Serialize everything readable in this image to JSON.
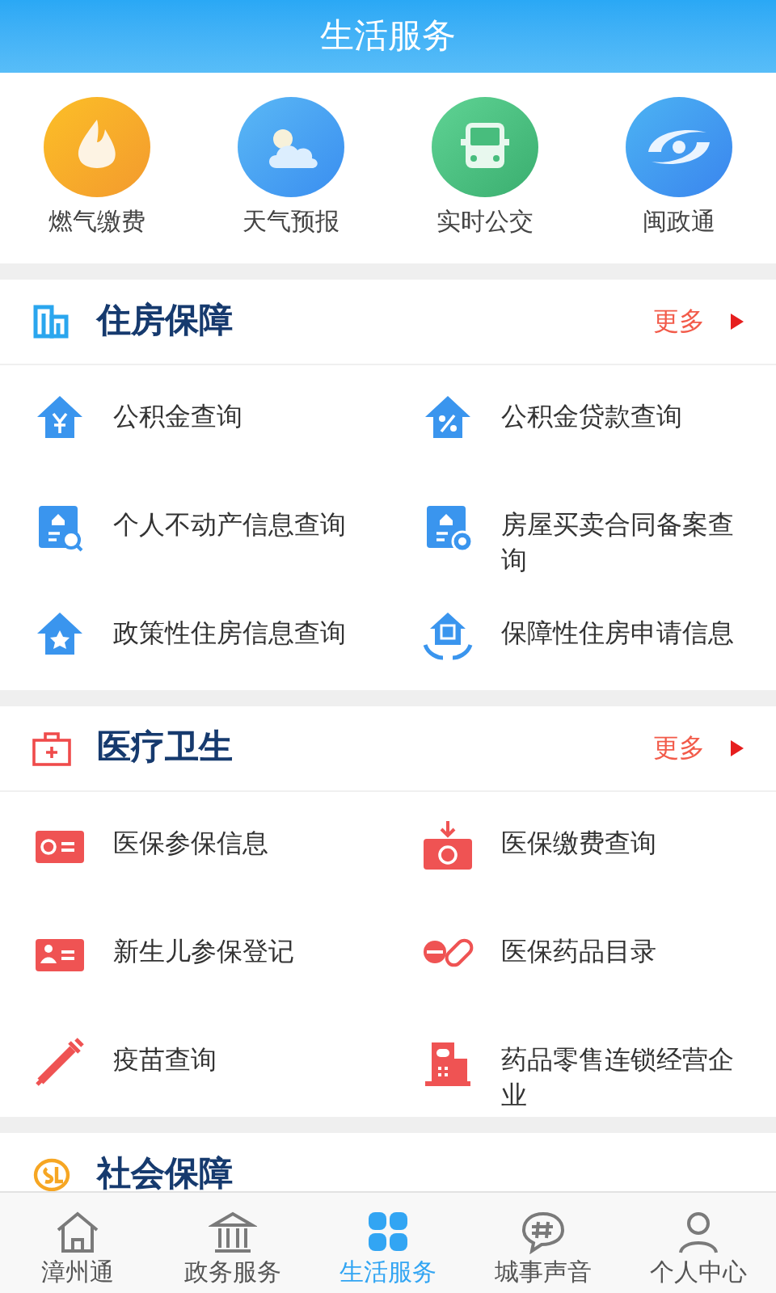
{
  "header": {
    "title": "生活服务"
  },
  "quick_links": [
    {
      "label": "燃气缴费"
    },
    {
      "label": "天气预报"
    },
    {
      "label": "实时公交"
    },
    {
      "label": "闽政通"
    }
  ],
  "sections": [
    {
      "title": "住房保障",
      "more": "更多",
      "items": [
        "公积金查询",
        "公积金贷款查询",
        "个人不动产信息查询",
        "房屋买卖合同备案查询",
        "政策性住房信息查询",
        "保障性住房申请信息"
      ]
    },
    {
      "title": "医疗卫生",
      "more": "更多",
      "items": [
        "医保参保信息",
        "医保缴费查询",
        "新生儿参保登记",
        "医保药品目录",
        "疫苗查询",
        "药品零售连锁经营企业"
      ]
    },
    {
      "title": "社会保障"
    }
  ],
  "tabs": [
    {
      "label": "漳州通",
      "selected": false
    },
    {
      "label": "政务服务",
      "selected": false
    },
    {
      "label": "生活服务",
      "selected": true
    },
    {
      "label": "城事声音",
      "selected": false
    },
    {
      "label": "个人中心",
      "selected": false
    }
  ]
}
